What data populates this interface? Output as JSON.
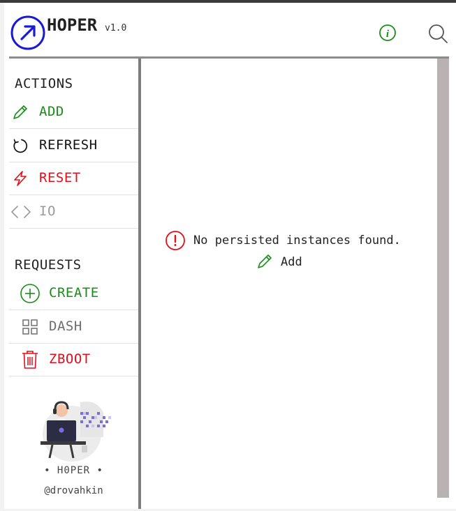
{
  "app": {
    "title": "HOPER",
    "version": "v1.0"
  },
  "colors": {
    "green": "#198c19",
    "red": "#e0101a",
    "gray": "#9a9a9a",
    "blue": "#1a1ad0"
  },
  "sidebar": {
    "actions_title": "ACTIONS",
    "actions": [
      {
        "label": "ADD",
        "icon": "pencil-icon"
      },
      {
        "label": "REFRESH",
        "icon": "refresh-icon"
      },
      {
        "label": "RESET",
        "icon": "lightning-icon"
      },
      {
        "label": "IO",
        "icon": "code-brackets-icon"
      }
    ],
    "requests_title": "REQUESTS",
    "requests": [
      {
        "label": "CREATE",
        "icon": "plus-circle-icon"
      },
      {
        "label": "DASH",
        "icon": "grid-icon"
      },
      {
        "label": "ZBOOT",
        "icon": "trash-icon"
      }
    ],
    "credit_name": "• H0PER •",
    "credit_handle": "@drovahkin"
  },
  "main": {
    "empty_message": "No persisted instances found.",
    "add_label": "Add"
  }
}
